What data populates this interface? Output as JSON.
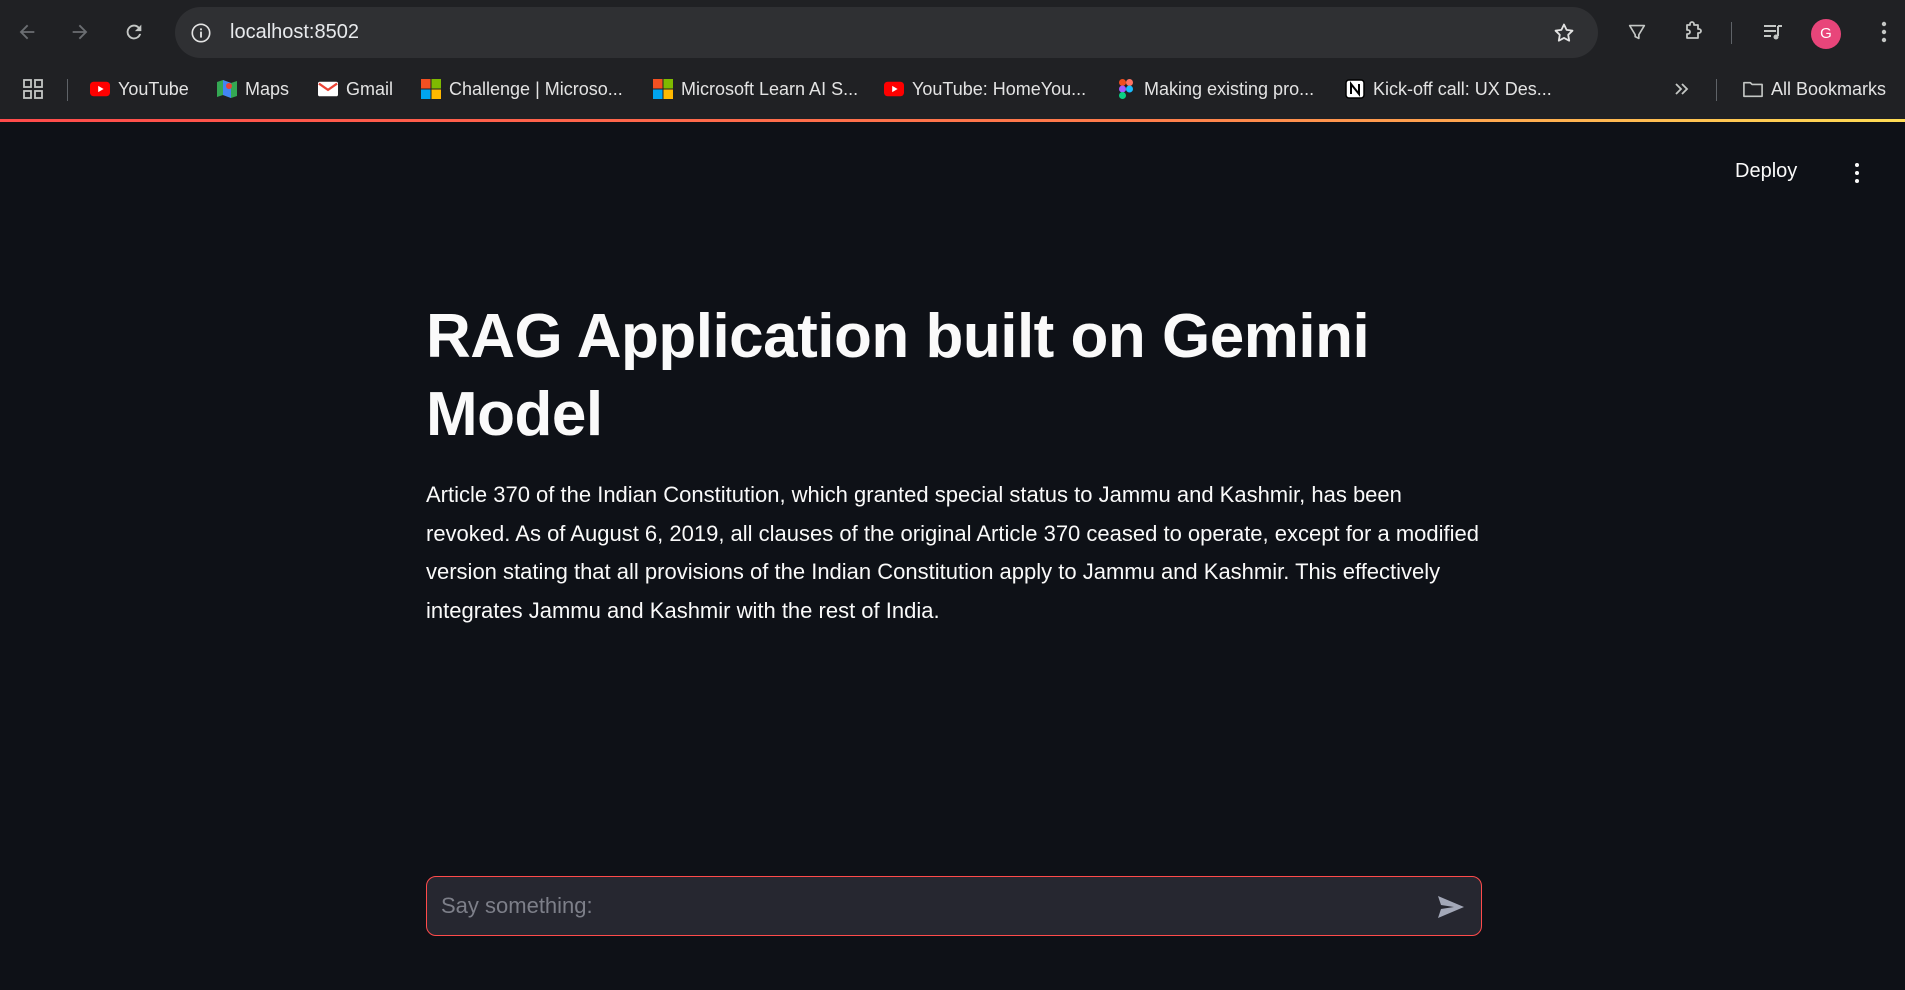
{
  "browser": {
    "url": "localhost:8502",
    "avatar_letter": "G",
    "bookmarks": [
      {
        "label": "YouTube",
        "icon": "youtube-icon"
      },
      {
        "label": "Maps",
        "icon": "maps-icon"
      },
      {
        "label": "Gmail",
        "icon": "gmail-icon"
      },
      {
        "label": "Challenge | Microso...",
        "icon": "microsoft-icon"
      },
      {
        "label": "Microsoft Learn AI S...",
        "icon": "microsoft-icon"
      },
      {
        "label": "YouTube: HomeYou...",
        "icon": "youtube-icon"
      },
      {
        "label": "Making existing pro...",
        "icon": "figma-icon"
      },
      {
        "label": "Kick-off call: UX Des...",
        "icon": "notion-icon"
      }
    ],
    "all_bookmarks_label": "All Bookmarks"
  },
  "app": {
    "deploy_label": "Deploy",
    "title": "RAG Application built on Gemini Model",
    "answer": "Article 370 of the Indian Constitution, which granted special status to Jammu and Kashmir, has been revoked. As of August 6, 2019, all clauses of the original Article 370 ceased to operate, except for a modified version stating that all provisions of the Indian Constitution apply to Jammu and Kashmir. This effectively integrates Jammu and Kashmir with the rest of India.",
    "chat_placeholder": "Say something:",
    "chat_value": ""
  },
  "colors": {
    "background": "#0e1117",
    "accent": "#ff4b4b",
    "input_bg": "#262730",
    "chrome_bg": "#202124"
  }
}
